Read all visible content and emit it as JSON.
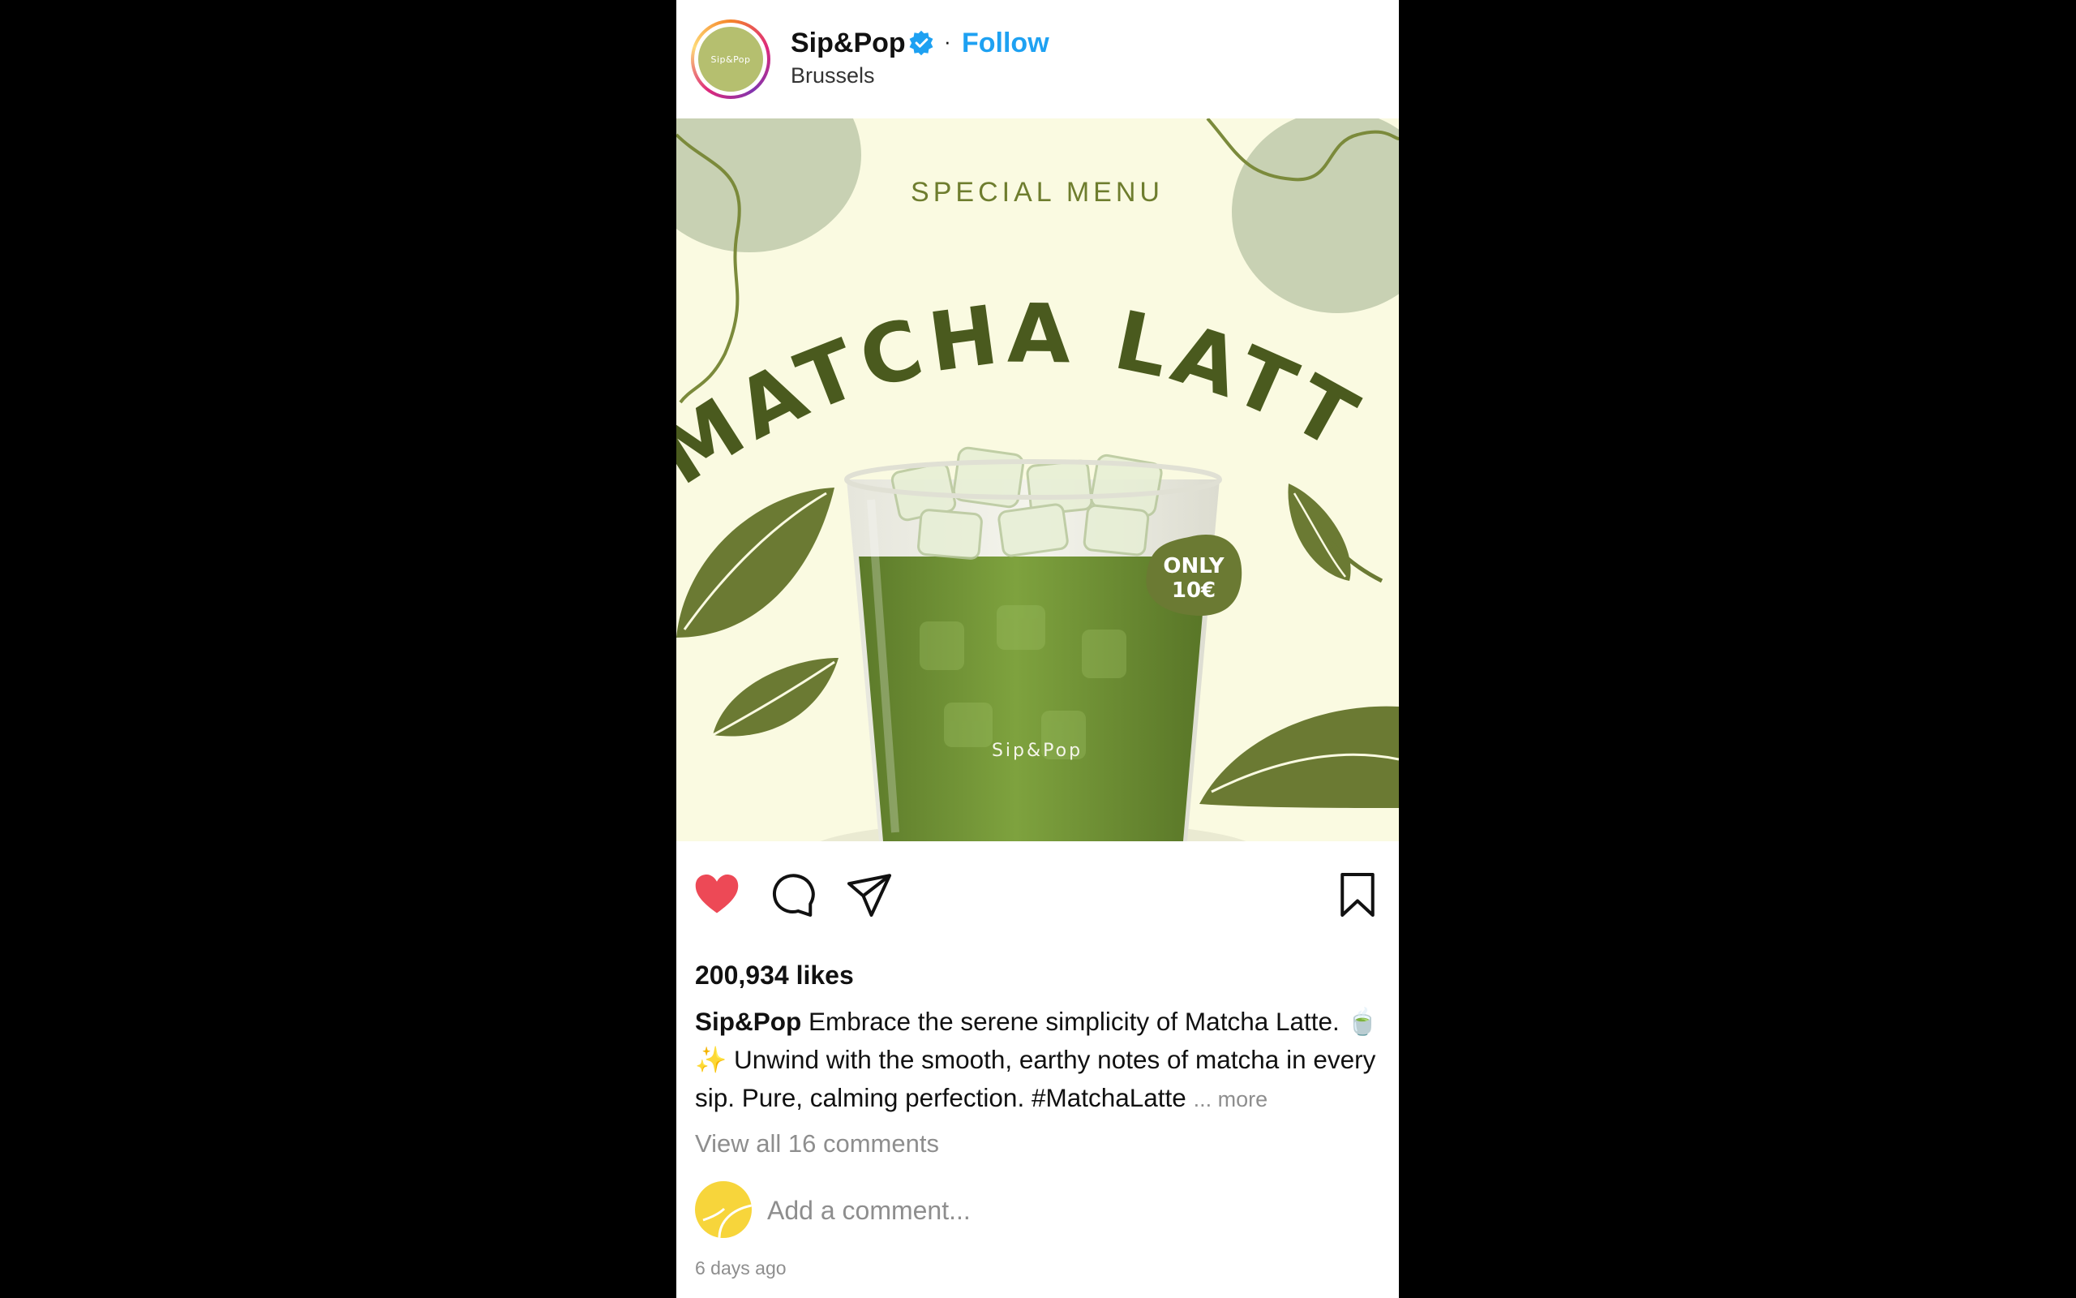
{
  "account": {
    "username": "Sip&Pop",
    "avatar_text": "Sip&Pop",
    "location": "Brussels",
    "follow_label": "Follow",
    "separator": "·",
    "verified": true
  },
  "image": {
    "headline_small": "SPECIAL MENU",
    "headline_big": "MATCHA LATTE",
    "price_line1": "ONLY",
    "price_line2": "10€",
    "cup_brand": "Sip&Pop"
  },
  "actions": {
    "liked": true,
    "icons": [
      "heart-icon",
      "comment-icon",
      "share-icon",
      "bookmark-icon"
    ]
  },
  "likes": "200,934 likes",
  "caption": {
    "username": "Sip&Pop",
    "text": " Embrace the serene simplicity of Matcha Latte. 🍵✨ Unwind with the smooth, earthy notes of matcha in every sip. Pure, calming perfection. #MatchaLatte ",
    "more": "... more"
  },
  "comments": {
    "view_all": "View all 16 comments",
    "placeholder": "Add a comment..."
  },
  "timestamp": "6 days ago",
  "colors": {
    "follow": "#1ea1f2",
    "heart": "#ed4956",
    "image_bg": "#fafae1",
    "matcha_dark": "#4a5a1e",
    "leaf": "#6b7a33",
    "blob": "#c8d1b3"
  }
}
